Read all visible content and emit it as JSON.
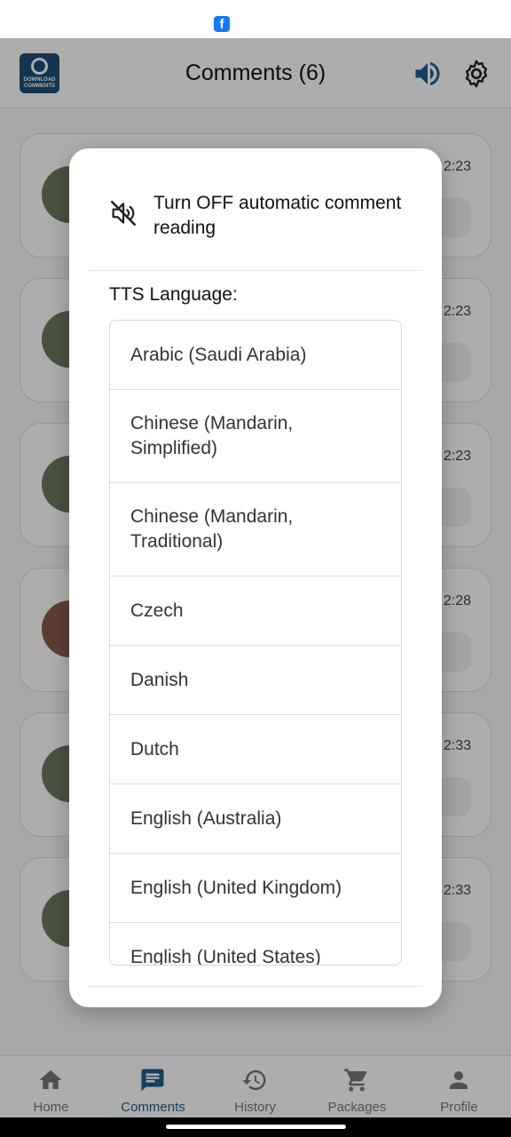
{
  "app": {
    "title": "Comments (6)"
  },
  "status_bar": {
    "notification_icon": "facebook-icon",
    "notification_glyph": "f"
  },
  "header": {
    "logo_text": "DOWNLOAD COMMENTS",
    "speaker_icon": "speaker-on-icon",
    "settings_icon": "gear-icon"
  },
  "comments": [
    {
      "time": "2:23"
    },
    {
      "time": "2:23"
    },
    {
      "time": "2:23"
    },
    {
      "time": "2:28"
    },
    {
      "time": "2:33"
    },
    {
      "time": "2:33"
    }
  ],
  "dialog": {
    "toggle_label": "Turn OFF automatic comment reading",
    "toggle_icon": "speaker-muted-icon",
    "language_label": "TTS Language:",
    "languages": [
      "Arabic (Saudi Arabia)",
      "Chinese (Mandarin, Simplified)",
      "Chinese (Mandarin, Traditional)",
      "Czech",
      "Danish",
      "Dutch",
      "English (Australia)",
      "English (United Kingdom)",
      "English (United States)"
    ]
  },
  "bottom_nav": {
    "items": [
      {
        "label": "Home",
        "icon": "home-icon"
      },
      {
        "label": "Comments",
        "icon": "comment-icon",
        "active": true
      },
      {
        "label": "History",
        "icon": "history-icon"
      },
      {
        "label": "Packages",
        "icon": "cart-icon"
      },
      {
        "label": "Profile",
        "icon": "person-icon"
      }
    ]
  },
  "colors": {
    "accent": "#1c5f8c",
    "scrim": "#000000",
    "facebook": "#1877f2"
  }
}
